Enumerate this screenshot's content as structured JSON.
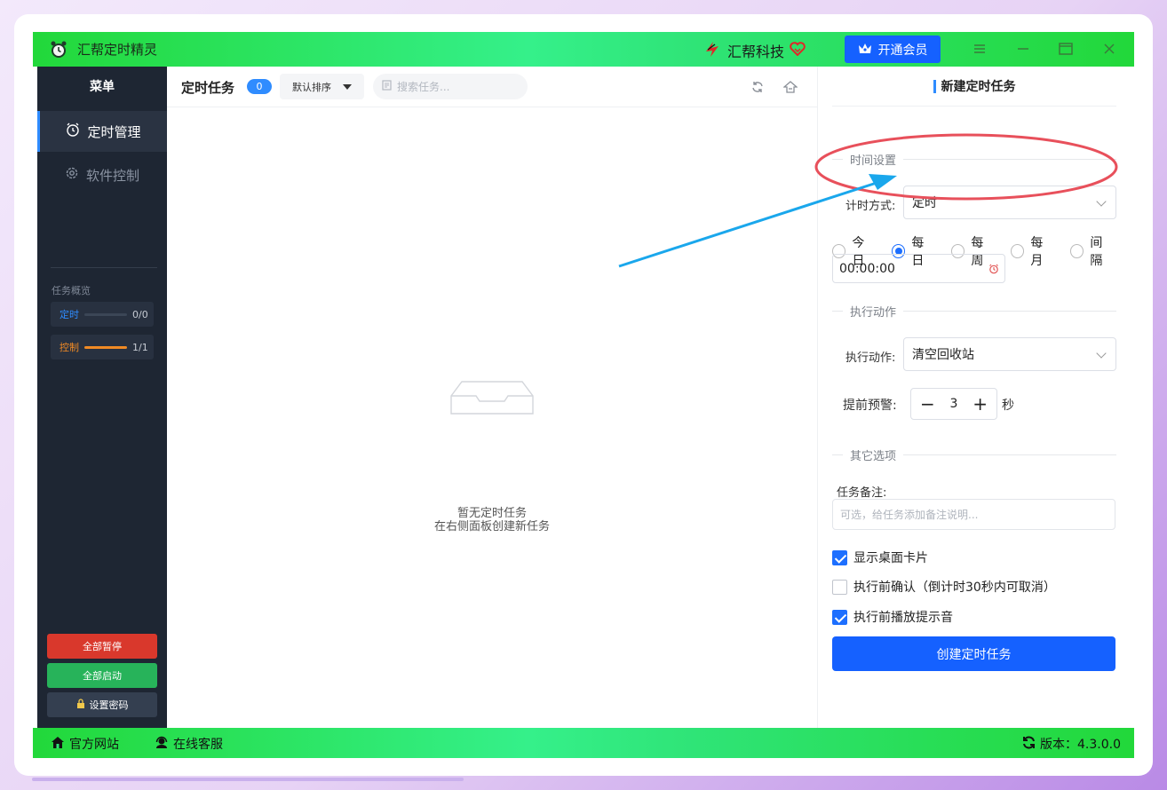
{
  "app": {
    "title": "汇帮定时精灵",
    "brand": "汇帮科技",
    "vip_label": "开通会员"
  },
  "sidebar": {
    "title": "菜单",
    "items": [
      {
        "label": "定时管理",
        "icon": "alarm-clock-icon",
        "active": true
      },
      {
        "label": "软件控制",
        "icon": "gear-icon",
        "active": false
      }
    ],
    "overview_title": "任务概览",
    "stats": [
      {
        "label": "定时",
        "value": "0/0",
        "fill_fraction": 0.0,
        "color": "#2f8cff"
      },
      {
        "label": "控制",
        "value": "1/1",
        "fill_fraction": 1.0,
        "color": "#f08a24"
      }
    ],
    "buttons": {
      "pause_all": "全部暂停",
      "start_all": "全部启动",
      "set_password": "设置密码"
    }
  },
  "main": {
    "title": "定时任务",
    "count": "0",
    "sort_label": "默认排序",
    "search_placeholder": "搜索任务...",
    "empty_line1": "暂无定时任务",
    "empty_line2": "在右侧面板创建新任务"
  },
  "panel": {
    "header": "新建定时任务",
    "section_time": "时间设置",
    "timing_mode_label": "计时方式:",
    "timing_mode_value": "定时",
    "frequency_options": [
      "今日",
      "每日",
      "每周",
      "每月",
      "间隔"
    ],
    "frequency_selected": "每日",
    "time_value": "00:00:00",
    "section_action": "执行动作",
    "action_label": "执行动作:",
    "action_value": "清空回收站",
    "warning_label": "提前预警:",
    "warning_value": "3",
    "warning_unit": "秒",
    "section_other": "其它选项",
    "note_label": "任务备注:",
    "note_placeholder": "可选，给任务添加备注说明...",
    "checks": [
      {
        "label": "显示桌面卡片",
        "checked": true
      },
      {
        "label": "执行前确认（倒计时30秒内可取消）",
        "checked": false
      },
      {
        "label": "执行前播放提示音",
        "checked": true
      }
    ],
    "create_label": "创建定时任务"
  },
  "statusbar": {
    "website": "官方网站",
    "support": "在线客服",
    "version": "版本：4.3.0.0"
  },
  "colors": {
    "accent": "#1561ff",
    "titlebar_green": "#2fe477",
    "sidebar_bg": "#1e2633",
    "pause_red": "#d9382c",
    "start_green": "#27b35a",
    "annotation_red": "#e8505b",
    "annotation_blue": "#1aa7ec"
  }
}
